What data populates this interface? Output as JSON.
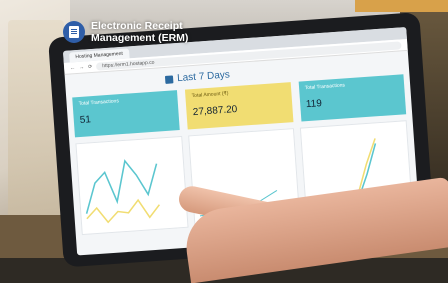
{
  "overlay": {
    "title_line1": "Electronic Receipt",
    "title_line2": "Management (ERM)",
    "icon": "receipt-document-icon",
    "accent": "#2f5ea8"
  },
  "browser": {
    "tab_label": "Hosting Management",
    "url": "https://erm1.hostapp.co"
  },
  "dashboard": {
    "title": "Last 7 Days",
    "cards": [
      {
        "label": "Total Transactions",
        "value": "51",
        "color": "#5bc6cf"
      },
      {
        "label": "Total Amount (₹)",
        "value": "27,887.20",
        "color": "#f1dd72"
      },
      {
        "label": "Total Transactions",
        "value": "119",
        "color": "#5bc6cf"
      }
    ]
  }
}
